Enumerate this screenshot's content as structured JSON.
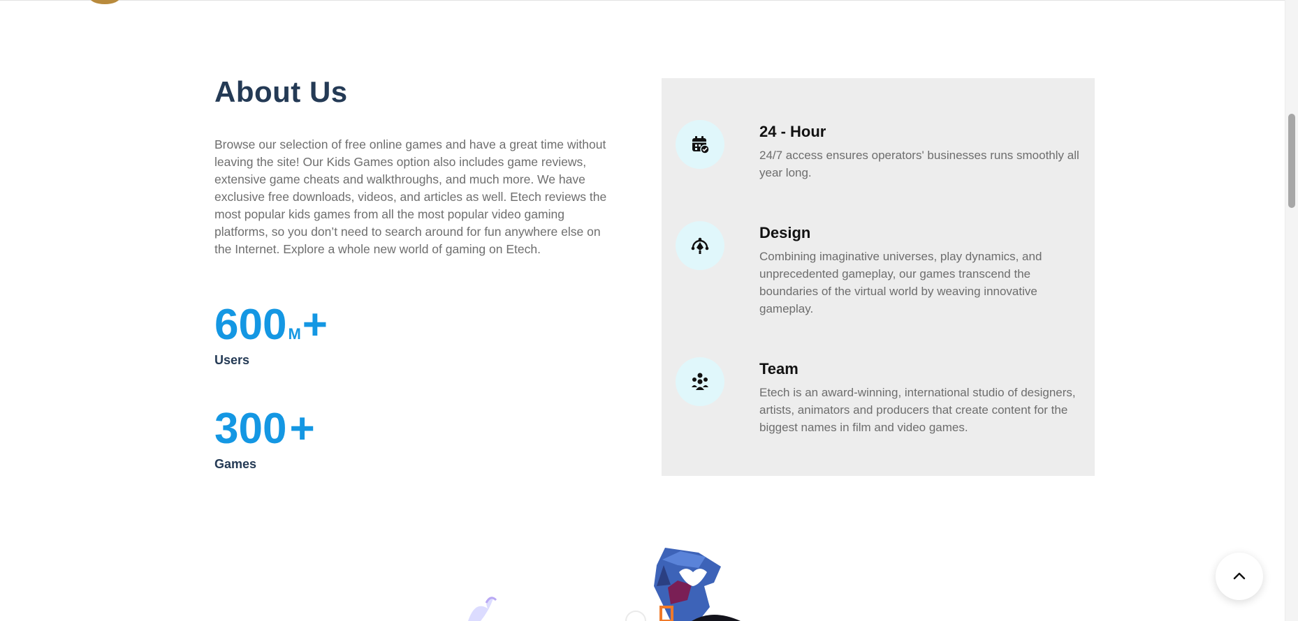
{
  "about": {
    "title": "About Us",
    "description": "Browse our selection of free online games and have a great time without leaving the site! Our Kids Games option also includes game reviews, extensive game cheats and walkthroughs, and much more. We have exclusive free downloads, videos, and articles as well. Etech reviews the most popular kids games from all the most popular video gaming platforms, so you don’t need to search around for fun anywhere else on the Internet. Explore a whole new world of gaming on Etech."
  },
  "stats": [
    {
      "number": "600",
      "unit": "M",
      "suffix": "+",
      "label": "Users"
    },
    {
      "number": "300",
      "unit": "",
      "suffix": "+",
      "label": "Games"
    }
  ],
  "features": [
    {
      "icon": "calendar-check-icon",
      "title": "24 - Hour",
      "description": "24/7 access ensures operators' businesses runs smoothly all year long."
    },
    {
      "icon": "design-pen-icon",
      "title": "Design",
      "description": "Combining imaginative universes, play dynamics, and unprecedented gameplay, our games transcend the boundaries of the virtual world by weaving innovative gameplay."
    },
    {
      "icon": "team-icon",
      "title": "Team",
      "description": "Etech is an award-winning, international studio of designers, artists, animators and producers that create content for the biggest names in film and video games."
    }
  ],
  "colors": {
    "heading": "#243a55",
    "accent": "#1497e3",
    "panel_bg": "#ededed",
    "icon_bg": "#e0f7fb"
  },
  "scroll_to_top_icon": "chevron-up-icon"
}
